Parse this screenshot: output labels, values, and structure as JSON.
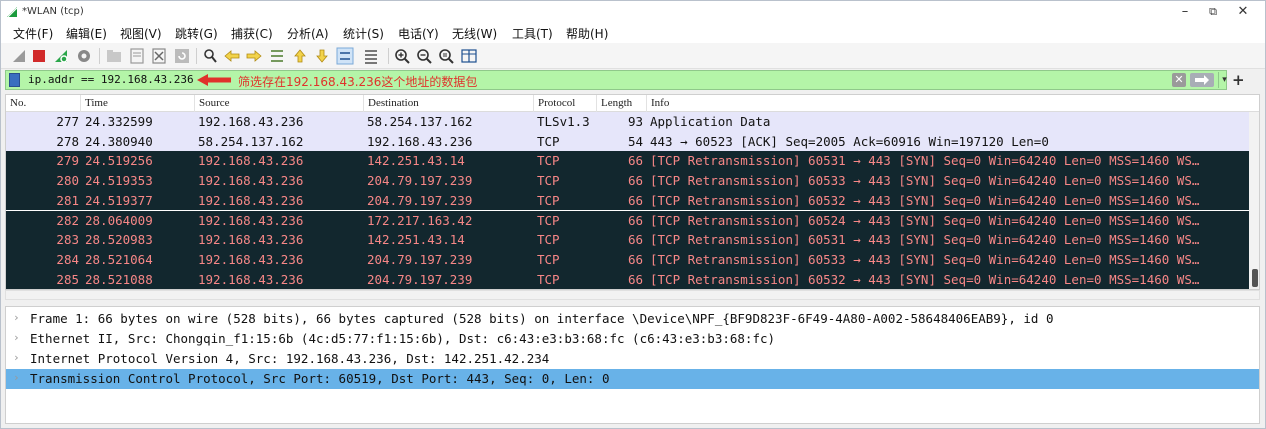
{
  "window": {
    "title": "*WLAN (tcp)",
    "controls": {
      "minimize": "–",
      "restore": "⧉",
      "close": "✕"
    }
  },
  "menu": [
    "文件(F)",
    "编辑(E)",
    "视图(V)",
    "跳转(G)",
    "捕获(C)",
    "分析(A)",
    "统计(S)",
    "电话(Y)",
    "无线(W)",
    "工具(T)",
    "帮助(H)"
  ],
  "filter": {
    "expression": "ip.addr == 192.168.43.236",
    "annotation": "筛选存在192.168.43.236这个地址的数据包",
    "background_color": "#b4f5a8",
    "annotation_color": "#e0322b"
  },
  "packet_list": {
    "columns": [
      "No.",
      "Time",
      "Source",
      "Destination",
      "Protocol",
      "Length",
      "Info"
    ],
    "rows": [
      {
        "no": "277",
        "time": "24.332599",
        "source": "192.168.43.236",
        "destination": "58.254.137.162",
        "protocol": "TLSv1.3",
        "length": "93",
        "info": "Application Data",
        "style": "light"
      },
      {
        "no": "278",
        "time": "24.380940",
        "source": "58.254.137.162",
        "destination": "192.168.43.236",
        "protocol": "TCP",
        "length": "54",
        "info": "443 → 60523 [ACK] Seq=2005 Ack=60916 Win=197120 Len=0",
        "style": "light"
      },
      {
        "no": "279",
        "time": "24.519256",
        "source": "192.168.43.236",
        "destination": "142.251.43.14",
        "protocol": "TCP",
        "length": "66",
        "info": "[TCP Retransmission] 60531 → 443 [SYN] Seq=0 Win=64240 Len=0 MSS=1460 WS…",
        "style": "dark"
      },
      {
        "no": "280",
        "time": "24.519353",
        "source": "192.168.43.236",
        "destination": "204.79.197.239",
        "protocol": "TCP",
        "length": "66",
        "info": "[TCP Retransmission] 60533 → 443 [SYN] Seq=0 Win=64240 Len=0 MSS=1460 WS…",
        "style": "dark"
      },
      {
        "no": "281",
        "time": "24.519377",
        "source": "192.168.43.236",
        "destination": "204.79.197.239",
        "protocol": "TCP",
        "length": "66",
        "info": "[TCP Retransmission] 60532 → 443 [SYN] Seq=0 Win=64240 Len=0 MSS=1460 WS…",
        "style": "dark"
      },
      {
        "no": "282",
        "time": "28.064009",
        "source": "192.168.43.236",
        "destination": "172.217.163.42",
        "protocol": "TCP",
        "length": "66",
        "info": "[TCP Retransmission] 60524 → 443 [SYN] Seq=0 Win=64240 Len=0 MSS=1460 WS…",
        "style": "dark"
      },
      {
        "no": "283",
        "time": "28.520983",
        "source": "192.168.43.236",
        "destination": "142.251.43.14",
        "protocol": "TCP",
        "length": "66",
        "info": "[TCP Retransmission] 60531 → 443 [SYN] Seq=0 Win=64240 Len=0 MSS=1460 WS…",
        "style": "dark"
      },
      {
        "no": "284",
        "time": "28.521064",
        "source": "192.168.43.236",
        "destination": "204.79.197.239",
        "protocol": "TCP",
        "length": "66",
        "info": "[TCP Retransmission] 60533 → 443 [SYN] Seq=0 Win=64240 Len=0 MSS=1460 WS…",
        "style": "dark"
      },
      {
        "no": "285",
        "time": "28.521088",
        "source": "192.168.43.236",
        "destination": "204.79.197.239",
        "protocol": "TCP",
        "length": "66",
        "info": "[TCP Retransmission] 60532 → 443 [SYN] Seq=0 Win=64240 Len=0 MSS=1460 WS…",
        "style": "dark"
      }
    ],
    "colors": {
      "light_bg": "#e6e6fa",
      "dark_bg": "#12272e",
      "dark_fg": "#f78787"
    }
  },
  "details": [
    {
      "text": "Frame 1: 66 bytes on wire (528 bits), 66 bytes captured (528 bits) on interface \\Device\\NPF_{BF9D823F-6F49-4A80-A002-58648406EAB9}, id 0",
      "selected": false
    },
    {
      "text": "Ethernet II, Src: Chongqin_f1:15:6b (4c:d5:77:f1:15:6b), Dst: c6:43:e3:b3:68:fc (c6:43:e3:b3:68:fc)",
      "selected": false
    },
    {
      "text": "Internet Protocol Version 4, Src: 192.168.43.236, Dst: 142.251.42.234",
      "selected": false
    },
    {
      "text": "Transmission Control Protocol, Src Port: 60519, Dst Port: 443, Seq: 0, Len: 0",
      "selected": true
    }
  ],
  "detail_chevron": "›",
  "toolbar_icons": [
    "shark-fin-start-icon",
    "stop-icon",
    "restart-icon",
    "options-gear-icon",
    "open-folder-icon",
    "save-icon",
    "close-file-icon",
    "reload-icon",
    "find-icon",
    "back-icon",
    "forward-icon",
    "goto-icon",
    "first-icon",
    "last-icon",
    "autoscroll-icon",
    "colorize-icon",
    "zoom-in-icon",
    "zoom-out-icon",
    "zoom-reset-icon",
    "resize-columns-icon"
  ]
}
